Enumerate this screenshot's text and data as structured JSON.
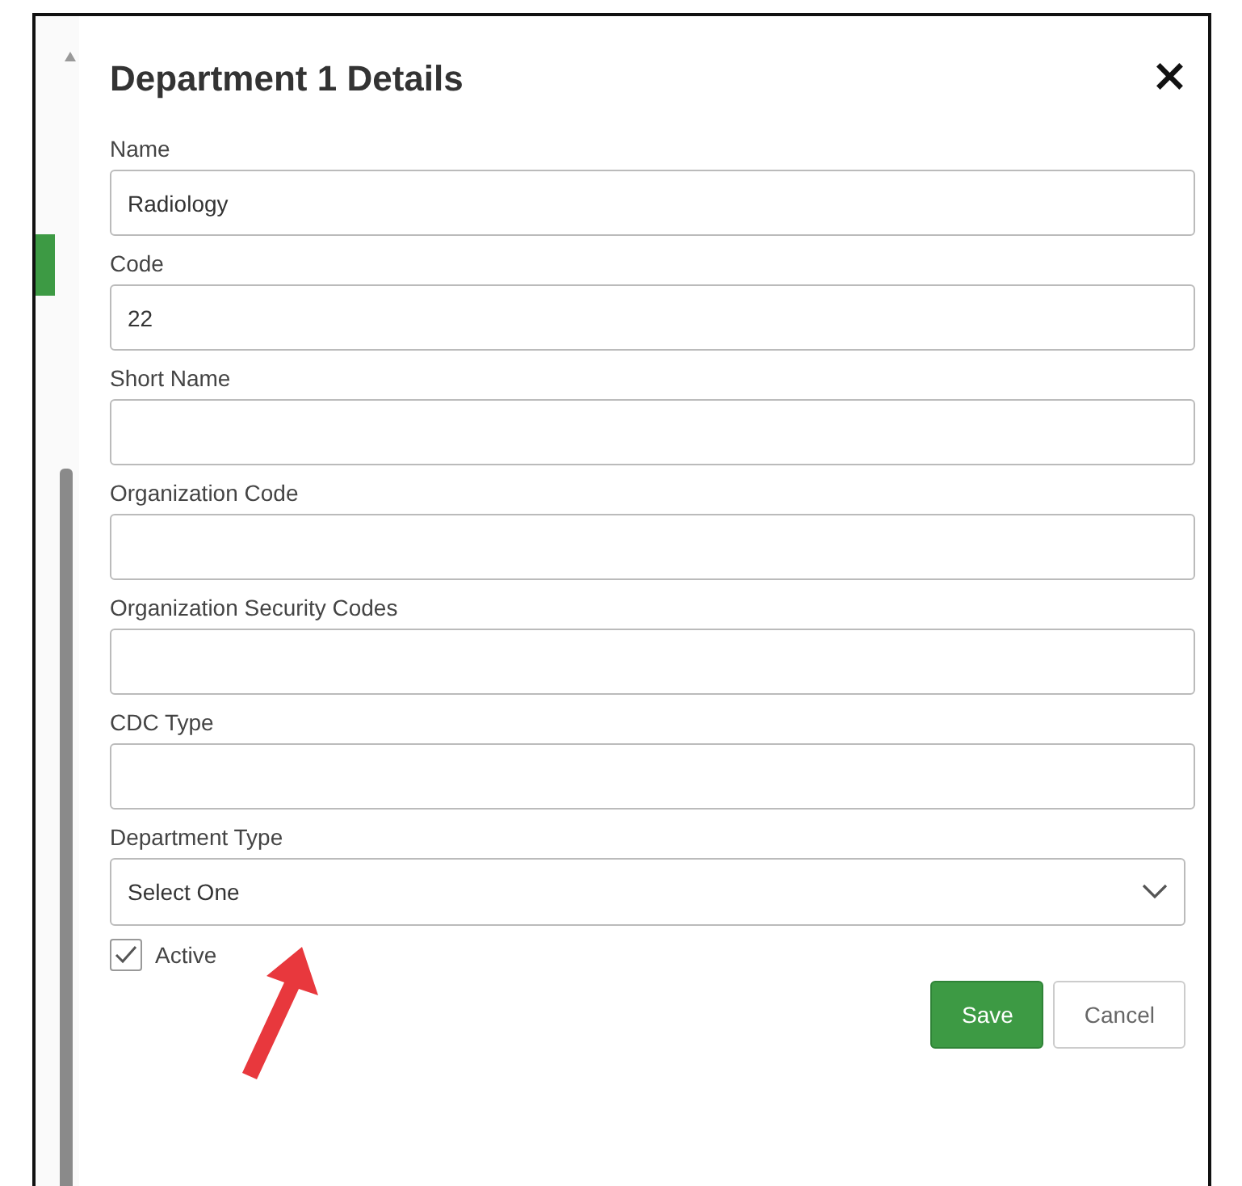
{
  "dialog": {
    "title": "Department 1 Details",
    "close": "×"
  },
  "fields": [
    {
      "kind": "text",
      "label": "Name",
      "value": "Radiology"
    },
    {
      "kind": "text",
      "label": "Code",
      "value": "22"
    },
    {
      "kind": "text",
      "label": "Short Name"
    },
    {
      "kind": "text",
      "label": "Organization Code"
    },
    {
      "kind": "text",
      "label": "Organization Security Codes"
    },
    {
      "kind": "text",
      "label": "CDC Type"
    },
    {
      "kind": "select",
      "label": "Department Type",
      "value": "Select One"
    }
  ],
  "active": {
    "label": "Active",
    "checked": true
  },
  "buttons": [
    {
      "kind": "primary",
      "label": "Save"
    },
    {
      "kind": "secondary",
      "label": "Cancel"
    }
  ]
}
